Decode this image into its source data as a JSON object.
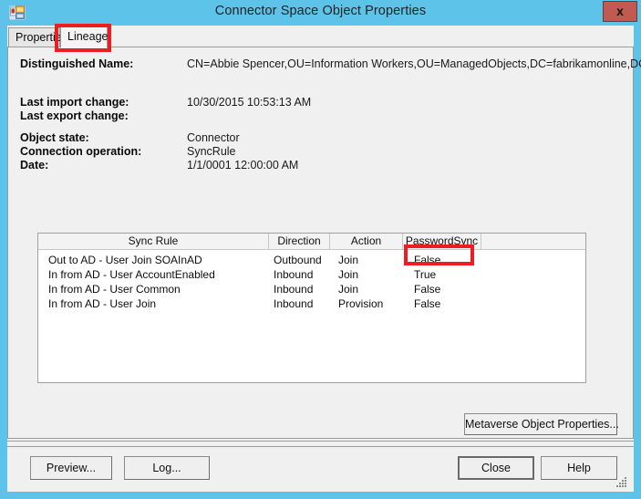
{
  "window": {
    "title": "Connector Space Object Properties",
    "icon": "window-properties-icon",
    "close_label": "x",
    "titlebar_color": "#5EC3E8",
    "close_button_color": "#C15B52",
    "annotation_color": "#EE1C23"
  },
  "tabs": [
    {
      "label": "Properties",
      "active": false
    },
    {
      "label": "Lineage",
      "active": true
    }
  ],
  "details": {
    "distinguished_name_label": "Distinguished Name:",
    "distinguished_name_value": "CN=Abbie Spencer,OU=Information Workers,OU=ManagedObjects,DC=fabrikamonline,DC=com",
    "last_import_change_label": "Last import change:",
    "last_import_change_value": "10/30/2015 10:53:13 AM",
    "last_export_change_label": "Last export change:",
    "last_export_change_value": "",
    "object_state_label": "Object state:",
    "object_state_value": "Connector",
    "connection_operation_label": "Connection operation:",
    "connection_operation_value": "SyncRule",
    "date_label": "Date:",
    "date_value": "1/1/0001 12:00:00 AM"
  },
  "lineage_table": {
    "columns": [
      "Sync Rule",
      "Direction",
      "Action",
      "PasswordSync",
      ""
    ],
    "rows": [
      {
        "sync_rule": "Out to AD - User Join SOAInAD",
        "direction": "Outbound",
        "action": "Join",
        "password_sync": "False",
        "highlighted": false
      },
      {
        "sync_rule": "In from AD - User AccountEnabled",
        "direction": "Inbound",
        "action": "Join",
        "password_sync": "True",
        "highlighted": true
      },
      {
        "sync_rule": "In from AD - User Common",
        "direction": "Inbound",
        "action": "Join",
        "password_sync": "False",
        "highlighted": false
      },
      {
        "sync_rule": "In from AD - User Join",
        "direction": "Inbound",
        "action": "Provision",
        "password_sync": "False",
        "highlighted": false
      }
    ]
  },
  "buttons": {
    "metaverse_object_properties": "Metaverse Object Properties...",
    "preview": "Preview...",
    "log": "Log...",
    "close": "Close",
    "help": "Help"
  }
}
